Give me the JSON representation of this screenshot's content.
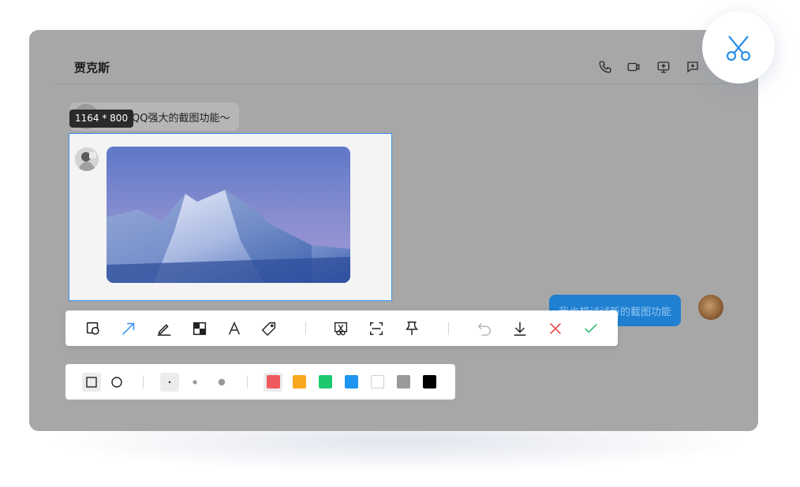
{
  "contact": {
    "name": "贾克斯"
  },
  "header_icons": [
    "phone-icon",
    "video-icon",
    "screen-share-icon",
    "add-chat-icon"
  ],
  "messages": {
    "incoming_text": "来试试QQ强大的截图功能～",
    "outgoing_text": "我也想试试新的截图功能"
  },
  "selection": {
    "size_label": "1164 * 800"
  },
  "toolbar": {
    "tools": [
      "rectangle-tool",
      "arrow-tool",
      "pen-tool",
      "mosaic-tool",
      "text-tool",
      "tag-tool",
      "crop-image-tool",
      "scroll-capture-tool",
      "pin-tool",
      "undo",
      "download",
      "cancel",
      "confirm"
    ],
    "accent": "#3a93f0",
    "cancel_color": "#e8444a",
    "confirm_color": "#2db86a"
  },
  "subtoolbar": {
    "shapes": [
      "square-shape",
      "circle-shape"
    ],
    "sizes": [
      "small",
      "medium",
      "large"
    ],
    "colors": [
      "#f05a5e",
      "#f8a81c",
      "#1ec96e",
      "#1e95f0",
      "#ffffff",
      "#9a9a9a",
      "#000000"
    ]
  }
}
